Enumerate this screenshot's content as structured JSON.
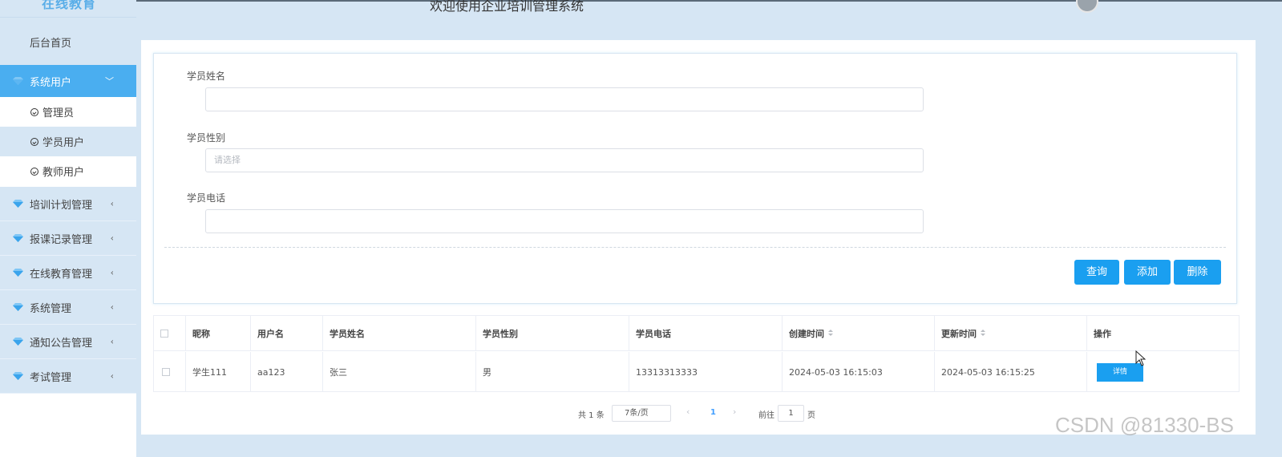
{
  "header": {
    "title": "欢迎使用企业培训管理系统",
    "logo": "在线教育"
  },
  "sidebar": {
    "home": "后台首页",
    "active_group": {
      "label": "系统用户",
      "expanded": true
    },
    "sub_items": [
      {
        "label": "管理员"
      },
      {
        "label": "学员用户"
      },
      {
        "label": "教师用户"
      }
    ],
    "groups": [
      {
        "label": "培训计划管理"
      },
      {
        "label": "报课记录管理"
      },
      {
        "label": "在线教育管理"
      },
      {
        "label": "系统管理"
      },
      {
        "label": "通知公告管理"
      },
      {
        "label": "考试管理"
      }
    ]
  },
  "form": {
    "name_label": "学员姓名",
    "name_value": "",
    "gender_label": "学员性别",
    "gender_placeholder": "请选择",
    "phone_label": "学员电话",
    "phone_value": ""
  },
  "buttons": {
    "query": "查询",
    "add": "添加",
    "delete": "删除"
  },
  "table": {
    "columns": [
      "昵称",
      "用户名",
      "学员姓名",
      "学员性别",
      "学员电话",
      "创建时间",
      "更新时间",
      "操作"
    ],
    "rows": [
      [
        "学生111",
        "aa123",
        "张三",
        "男",
        "13313313333",
        "2024-05-03 16:15:03",
        "2024-05-03 16:15:25"
      ]
    ],
    "detail_label": "详情"
  },
  "pagination": {
    "total": "共 1 条",
    "page_size": "7条/页",
    "current_page": "1",
    "goto_label": "前往",
    "goto_value": "1",
    "page_unit": "页"
  },
  "watermark": "CSDN @81330-BS",
  "colors": {
    "accent": "#1a9ff0",
    "sidebar_active": "#4aaef0",
    "background": "#d6e6f4"
  }
}
